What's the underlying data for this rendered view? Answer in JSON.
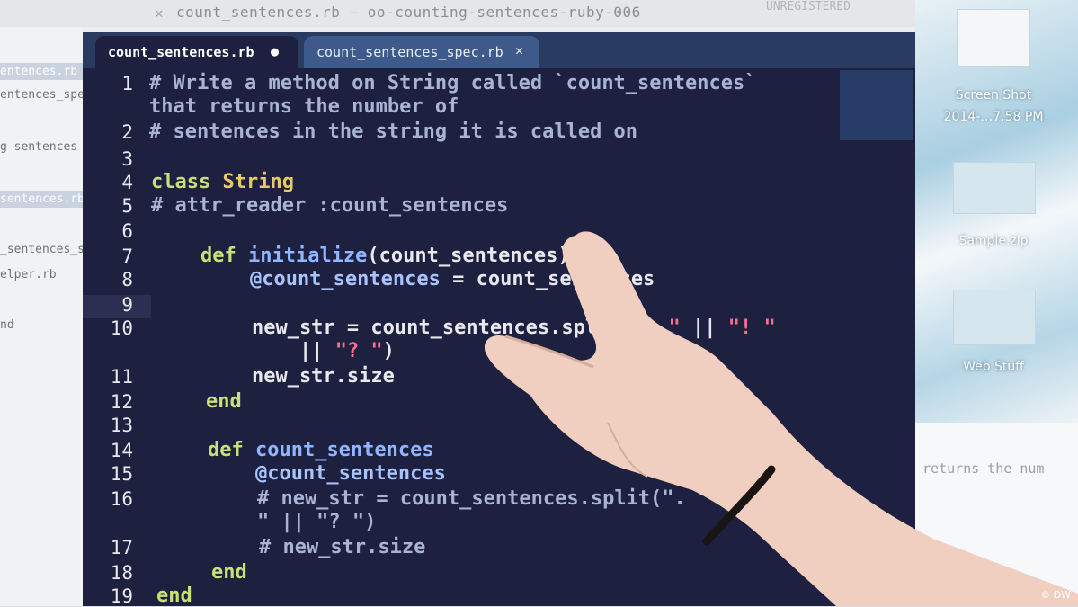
{
  "background": {
    "window_title": "count_sentences.rb — oo-counting-sentences-ruby-006",
    "unregistered": "UNREGISTERED",
    "sidebar_items": [
      "entences.rb",
      "entences_spec.rb",
      "g-sentences",
      "sentences.rb",
      "_sentences_s",
      "elper.rb",
      "nd"
    ],
    "desktop_labels": [
      "Screen Shot",
      "2014-…7.58 PM",
      "Sample.zip",
      "Web Stuff"
    ],
    "right_text": "returns the num"
  },
  "editor": {
    "tabs": [
      {
        "label": "count_sentences.rb",
        "active": true,
        "marker": "●"
      },
      {
        "label": "count_sentences_spec.rb",
        "active": false,
        "marker": "✕"
      }
    ],
    "lines": [
      {
        "n": "1",
        "segments": [
          {
            "t": "# Write a method on String called `count_sentences`",
            "c": "comment"
          }
        ]
      },
      {
        "n": "",
        "segments": [
          {
            "t": "that returns the number of",
            "c": "comment"
          }
        ]
      },
      {
        "n": "2",
        "segments": [
          {
            "t": "# sentences in the string it is called on",
            "c": "comment"
          }
        ]
      },
      {
        "n": "3",
        "segments": []
      },
      {
        "n": "4",
        "segments": [
          {
            "t": "class ",
            "c": "kw"
          },
          {
            "t": "String",
            "c": "cls"
          }
        ]
      },
      {
        "n": "5",
        "segments": [
          {
            "t": "# attr_reader :count_sentences",
            "c": "comment"
          }
        ]
      },
      {
        "n": "6",
        "segments": []
      },
      {
        "n": "7",
        "segments": [
          {
            "t": "    def ",
            "c": "kw"
          },
          {
            "t": "initialize",
            "c": "fn"
          },
          {
            "t": "(count_sentences)",
            "c": "plain"
          }
        ]
      },
      {
        "n": "8",
        "segments": [
          {
            "t": "        @count_sentences",
            "c": "ivar"
          },
          {
            "t": " = count_sentences",
            "c": "plain"
          }
        ]
      },
      {
        "n": "9",
        "segments": []
      },
      {
        "n": "10",
        "segments": [
          {
            "t": "        new_str = count_sentences.split(",
            "c": "plain"
          },
          {
            "t": "\". \"",
            "c": "str"
          },
          {
            "t": " || ",
            "c": "plain"
          },
          {
            "t": "\"! \"",
            "c": "str"
          }
        ]
      },
      {
        "n": "",
        "segments": [
          {
            "t": "            || ",
            "c": "plain"
          },
          {
            "t": "\"? \"",
            "c": "str"
          },
          {
            "t": ")",
            "c": "plain"
          }
        ]
      },
      {
        "n": "11",
        "segments": [
          {
            "t": "        new_str.size",
            "c": "plain"
          }
        ]
      },
      {
        "n": "12",
        "segments": [
          {
            "t": "    end",
            "c": "kw"
          }
        ]
      },
      {
        "n": "13",
        "segments": []
      },
      {
        "n": "14",
        "segments": [
          {
            "t": "    def ",
            "c": "kw"
          },
          {
            "t": "count_sentences",
            "c": "fn"
          }
        ]
      },
      {
        "n": "15",
        "segments": [
          {
            "t": "        @count_sentences",
            "c": "ivar"
          }
        ]
      },
      {
        "n": "16",
        "segments": [
          {
            "t": "        # new_str = count_sentences.split(\". \" || \"!",
            "c": "comment"
          }
        ]
      },
      {
        "n": "",
        "segments": [
          {
            "t": "        \" || \"? \")",
            "c": "comment"
          }
        ]
      },
      {
        "n": "17",
        "segments": [
          {
            "t": "        # new_str.size",
            "c": "comment"
          }
        ]
      },
      {
        "n": "18",
        "segments": [
          {
            "t": "    end",
            "c": "kw"
          }
        ]
      },
      {
        "n": "19",
        "segments": [
          {
            "t": "end",
            "c": "kw"
          }
        ]
      }
    ]
  },
  "watermark": "© DW"
}
